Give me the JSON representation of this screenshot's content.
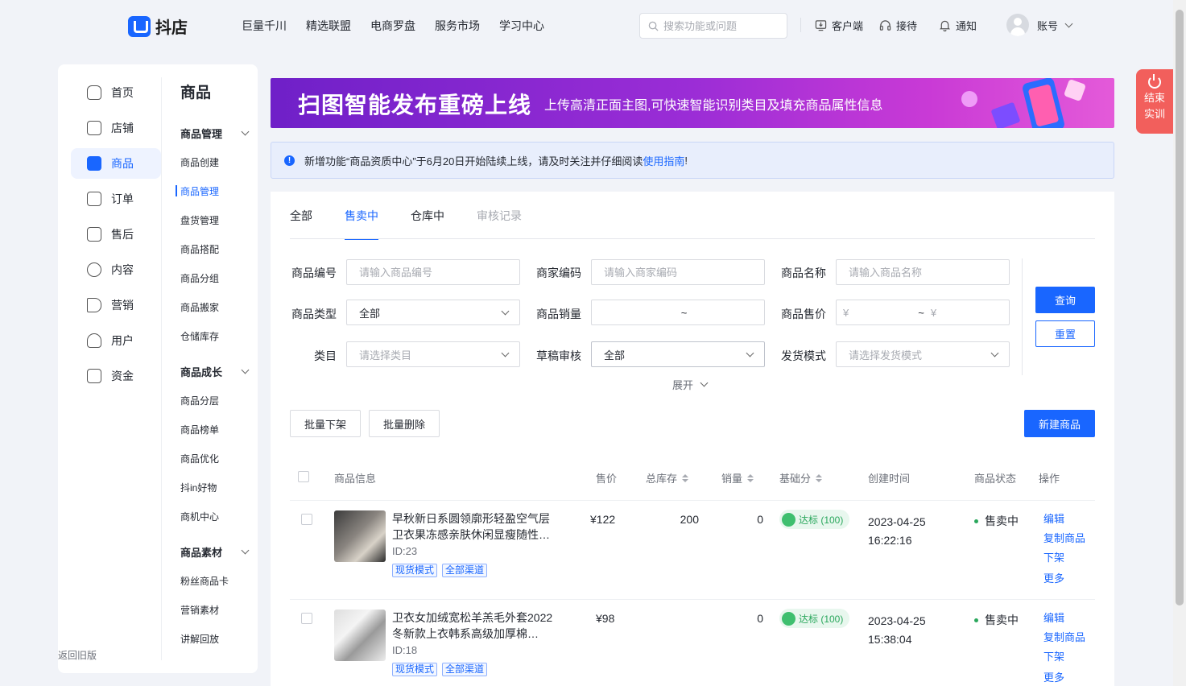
{
  "header": {
    "logo_text": "抖店",
    "nav": [
      "巨量千川",
      "精选联盟",
      "电商罗盘",
      "服务市场",
      "学习中心"
    ],
    "search_placeholder": "搜索功能或问题",
    "client": "客户端",
    "reception": "接待",
    "notify": "通知",
    "account": "账号"
  },
  "sidebar": {
    "items": [
      {
        "label": "首页",
        "icon": "home-icon"
      },
      {
        "label": "店铺",
        "icon": "shop-icon"
      },
      {
        "label": "商品",
        "icon": "goods-icon"
      },
      {
        "label": "订单",
        "icon": "order-icon"
      },
      {
        "label": "售后",
        "icon": "aftersale-icon"
      },
      {
        "label": "内容",
        "icon": "content-icon"
      },
      {
        "label": "营销",
        "icon": "marketing-icon"
      },
      {
        "label": "用户",
        "icon": "user-icon"
      },
      {
        "label": "资金",
        "icon": "funds-icon"
      }
    ],
    "active_index": 2,
    "back_old": "返回旧版"
  },
  "subnav": {
    "title": "商品",
    "group1": {
      "label": "商品管理",
      "items": [
        "商品创建",
        "商品管理",
        "盘货管理",
        "商品搭配",
        "商品分组",
        "商品搬家",
        "仓储库存"
      ]
    },
    "group2": {
      "label": "商品成长",
      "items": [
        "商品分层",
        "商品榜单",
        "商品优化",
        "抖in好物",
        "商机中心"
      ]
    },
    "group3": {
      "label": "商品素材",
      "items": [
        "粉丝商品卡",
        "营销素材",
        "讲解回放"
      ]
    },
    "active_item": "商品管理"
  },
  "banner": {
    "title": "扫图智能发布重磅上线",
    "subtitle": "上传高清正面主图,可快速智能识别类目及填充商品属性信息"
  },
  "notice": {
    "text": "新增功能“商品资质中心”于6月20日开始陆续上线，请及时关注并仔细阅读",
    "link": "使用指南",
    "suffix": "!"
  },
  "tabs": [
    {
      "label": "全部",
      "state": "normal"
    },
    {
      "label": "售卖中",
      "state": "active"
    },
    {
      "label": "仓库中",
      "state": "normal"
    },
    {
      "label": "审核记录",
      "state": "disabled"
    }
  ],
  "filters": {
    "goods_id": {
      "label": "商品编号",
      "placeholder": "请输入商品编号"
    },
    "merchant_code": {
      "label": "商家编码",
      "placeholder": "请输入商家编码"
    },
    "goods_name": {
      "label": "商品名称",
      "placeholder": "请输入商品名称"
    },
    "goods_type": {
      "label": "商品类型",
      "value": "全部"
    },
    "sales": {
      "label": "商品销量",
      "sep": "~"
    },
    "price": {
      "label": "商品售价",
      "from": "¥",
      "sep": "~",
      "to": "¥"
    },
    "category": {
      "label": "类目",
      "placeholder": "请选择类目"
    },
    "draft_review": {
      "label": "草稿审核",
      "value": "全部"
    },
    "ship_mode": {
      "label": "发货模式",
      "placeholder": "请选择发货模式"
    },
    "query": "查询",
    "reset": "重置",
    "expand": "展开"
  },
  "actions": {
    "batch_off": "批量下架",
    "batch_delete": "批量删除",
    "new_goods": "新建商品"
  },
  "table": {
    "columns": [
      "商品信息",
      "售价",
      "总库存",
      "销量",
      "基础分",
      "创建时间",
      "商品状态",
      "操作"
    ],
    "rows": [
      {
        "title": "早秋新日系圆领廓形轻盈空气层卫衣果冻感亲肤休闲显瘦随性…",
        "id": "ID:23",
        "tags": [
          "现货模式",
          "全部渠道"
        ],
        "price": "¥122",
        "stock": "200",
        "sales": "0",
        "score": "达标 (100)",
        "date": "2023-04-25",
        "time": "16:22:16",
        "status": "售卖中",
        "ops": [
          "编辑",
          "复制商品",
          "下架",
          "更多"
        ]
      },
      {
        "title": "卫衣女加绒宽松羊羔毛外套2022冬新款上衣韩系高级加厚棉…",
        "id": "ID:18",
        "tags": [
          "现货模式",
          "全部渠道"
        ],
        "price": "¥98",
        "stock": "",
        "sales": "0",
        "score": "达标 (100)",
        "date": "2023-04-25",
        "time": "15:38:04",
        "status": "售卖中",
        "ops": [
          "编辑",
          "复制商品",
          "下架",
          "更多"
        ]
      }
    ]
  },
  "float_btn": {
    "label": "结束实训"
  },
  "colors": {
    "accent": "#1966ff",
    "success": "#2aa75c",
    "danger": "#f25f5c"
  }
}
